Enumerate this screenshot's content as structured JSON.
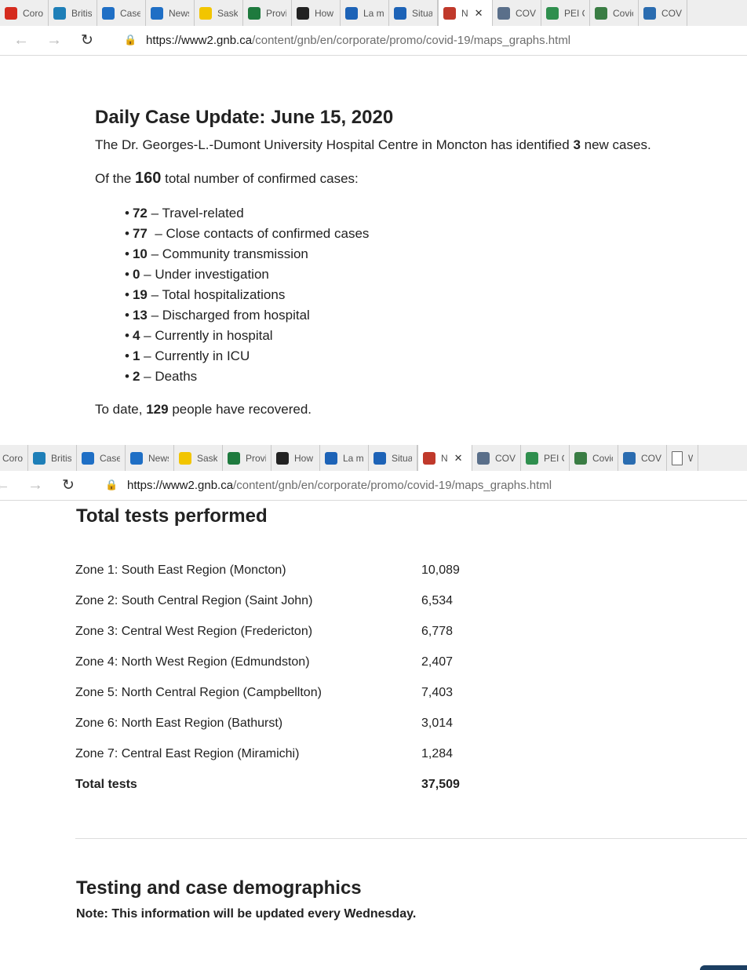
{
  "browser_top": {
    "tabs": [
      {
        "label": "Coro",
        "icon": "maple-leaf-icon",
        "color": "#d52b1e"
      },
      {
        "label": "Britis",
        "icon": "bc-icon",
        "color": "#1e7fb8"
      },
      {
        "label": "Cases",
        "icon": "alberta-icon",
        "color": "#1f6fc5"
      },
      {
        "label": "News",
        "icon": "alberta-icon",
        "color": "#1f6fc5"
      },
      {
        "label": "Saska",
        "icon": "saskatchewan-icon",
        "color": "#f2c500"
      },
      {
        "label": "Provi",
        "icon": "manitoba-icon",
        "color": "#1e7a3e"
      },
      {
        "label": "How",
        "icon": "ontario-icon",
        "color": "#222222"
      },
      {
        "label": "La ma",
        "icon": "quebec-icon",
        "color": "#1d63b7"
      },
      {
        "label": "Situat",
        "icon": "quebec-icon",
        "color": "#1d63b7"
      },
      {
        "label": "N",
        "icon": "nb-icon",
        "color": "#c0392b",
        "active": true
      },
      {
        "label": "COVI",
        "icon": "ns-icon",
        "color": "#5a6f8a"
      },
      {
        "label": "PEI C",
        "icon": "pei-icon",
        "color": "#2f8f4e"
      },
      {
        "label": "Covic",
        "icon": "globe-icon",
        "color": "#3a7d44"
      },
      {
        "label": "COVI",
        "icon": "nl-icon",
        "color": "#2a6cb0"
      }
    ],
    "url_host": "https://www2.gnb.ca",
    "url_path": "/content/gnb/en/corporate/promo/covid-19/maps_graphs.html"
  },
  "browser_mid": {
    "tabs": [
      {
        "label": "Coro",
        "icon": "maple-leaf-icon",
        "color": "#d52b1e"
      },
      {
        "label": "Britis",
        "icon": "bc-icon",
        "color": "#1e7fb8"
      },
      {
        "label": "Cases",
        "icon": "alberta-icon",
        "color": "#1f6fc5"
      },
      {
        "label": "News",
        "icon": "alberta-icon",
        "color": "#1f6fc5"
      },
      {
        "label": "Saska",
        "icon": "saskatchewan-icon",
        "color": "#f2c500"
      },
      {
        "label": "Provi",
        "icon": "manitoba-icon",
        "color": "#1e7a3e"
      },
      {
        "label": "How",
        "icon": "ontario-icon",
        "color": "#222222"
      },
      {
        "label": "La ma",
        "icon": "quebec-icon",
        "color": "#1d63b7"
      },
      {
        "label": "Situat",
        "icon": "quebec-icon",
        "color": "#1d63b7"
      },
      {
        "label": "N",
        "icon": "nb-icon",
        "color": "#c0392b",
        "active": true
      },
      {
        "label": "COVI",
        "icon": "ns-icon",
        "color": "#5a6f8a"
      },
      {
        "label": "PEI C",
        "icon": "pei-icon",
        "color": "#2f8f4e"
      },
      {
        "label": "Covic",
        "icon": "globe-icon",
        "color": "#3a7d44"
      },
      {
        "label": "COVI",
        "icon": "nl-icon",
        "color": "#2a6cb0"
      },
      {
        "label": "W",
        "icon": "page-icon",
        "color": "#ffffff"
      }
    ],
    "url_host": "https://www2.gnb.ca",
    "url_path": "/content/gnb/en/corporate/promo/covid-19/maps_graphs.html"
  },
  "update": {
    "title": "Daily Case Update: June 15, 2020",
    "new_cases_pre": "The Dr. Georges-L.-Dumont University Hospital Centre in Moncton has identified ",
    "new_cases_num": "3",
    "new_cases_post": " new cases.",
    "confirmed_pre": "Of the ",
    "confirmed_num": "160",
    "confirmed_post": " total number of confirmed cases:",
    "bullets": [
      {
        "num": "72",
        "text": " – Travel-related"
      },
      {
        "num": "77",
        "text": "  – Close contacts of confirmed cases"
      },
      {
        "num": "10",
        "text": " – Community transmission"
      },
      {
        "num": "0",
        "text": " – Under investigation"
      },
      {
        "num": "19",
        "text": " – Total hospitalizations"
      },
      {
        "num": "13",
        "text": " – Discharged from hospital"
      },
      {
        "num": "4",
        "text": " – Currently in hospital"
      },
      {
        "num": "1",
        "text": " – Currently in ICU"
      },
      {
        "num": "2",
        "text": " – Deaths"
      }
    ],
    "recovered_pre": "To date, ",
    "recovered_num": "129",
    "recovered_post": " people have recovered."
  },
  "tests": {
    "title": "Total tests performed",
    "rows": [
      {
        "zone": "Zone 1: South East Region (Moncton)",
        "value": "10,089"
      },
      {
        "zone": "Zone 2: South Central Region (Saint John)",
        "value": "6,534"
      },
      {
        "zone": "Zone 3: Central West Region (Fredericton)",
        "value": "6,778"
      },
      {
        "zone": "Zone 4: North West Region (Edmundston)",
        "value": "2,407"
      },
      {
        "zone": "Zone 5: North Central Region (Campbellton)",
        "value": "7,403"
      },
      {
        "zone": "Zone 6: North East Region (Bathurst)",
        "value": "3,014"
      },
      {
        "zone": "Zone 7: Central East Region (Miramichi)",
        "value": "1,284"
      }
    ],
    "total_label": "Total tests",
    "total_value": "37,509"
  },
  "demographics": {
    "title": "Testing and case demographics",
    "note": "Note: This information will be updated every Wednesday."
  }
}
